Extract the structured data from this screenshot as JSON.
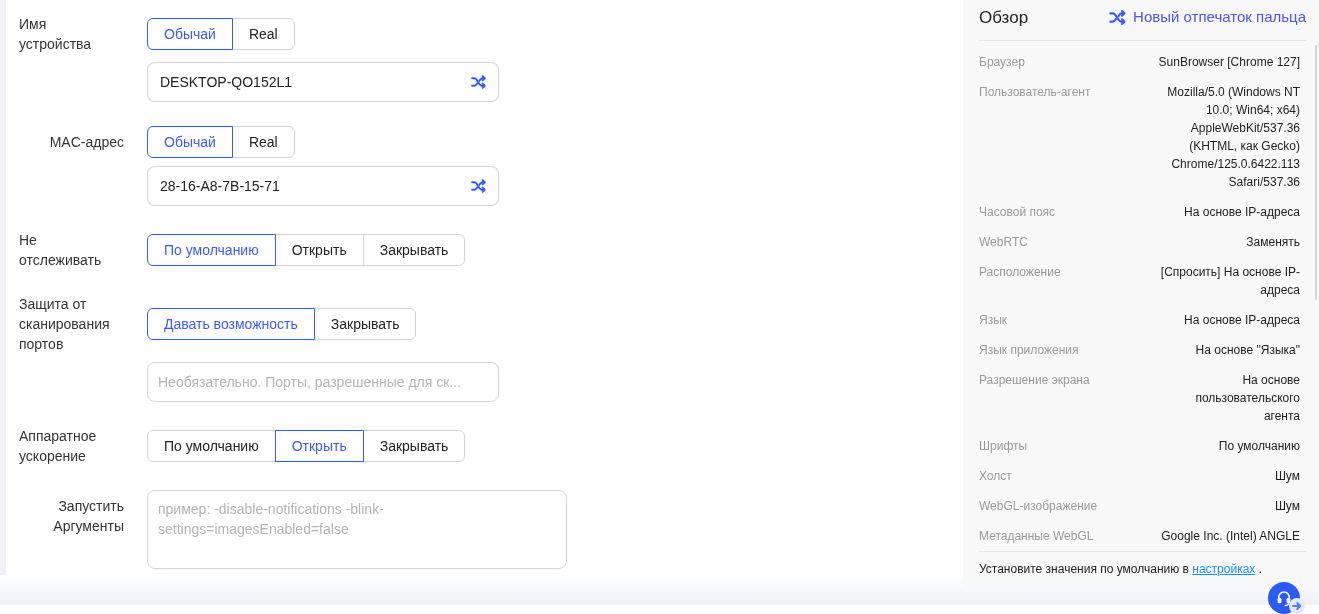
{
  "form": {
    "rows": [
      {
        "label": "Имя устройства",
        "options": [
          {
            "label": "Обычай",
            "selected": true
          },
          {
            "label": "Real",
            "selected": false
          }
        ],
        "field": {
          "kind": "input",
          "value": "DESKTOP-QO152L1",
          "randomize_button": true
        }
      },
      {
        "label": "MAC-адрес",
        "options": [
          {
            "label": "Обычай",
            "selected": true
          },
          {
            "label": "Real",
            "selected": false
          }
        ],
        "field": {
          "kind": "input",
          "value": "28-16-A8-7B-15-71",
          "randomize_button": true
        }
      },
      {
        "label": "Не отслеживать",
        "options": [
          {
            "label": "По умолчанию",
            "selected": true
          },
          {
            "label": "Открыть",
            "selected": false
          },
          {
            "label": "Закрывать",
            "selected": false
          }
        ]
      },
      {
        "label": "Защита от сканирования портов",
        "options": [
          {
            "label": "Давать возможность",
            "selected": true
          },
          {
            "label": "Закрывать",
            "selected": false
          }
        ],
        "field": {
          "kind": "input",
          "placeholder": "Необязательно. Порты, разрешенные для ск..."
        }
      },
      {
        "label": "Аппаратное ускорение",
        "options": [
          {
            "label": "По умолчанию",
            "selected": false
          },
          {
            "label": "Открыть",
            "selected": true
          },
          {
            "label": "Закрывать",
            "selected": false
          }
        ]
      },
      {
        "label": "Запустить Аргументы",
        "field": {
          "kind": "textarea",
          "placeholder": "пример: -disable-notifications -blink-settings=imagesEnabled=false"
        }
      }
    ]
  },
  "overview": {
    "title": "Обзор",
    "action": "Новый отпечаток пальца",
    "items": [
      {
        "label": "Браузер",
        "value": "SunBrowser [Chrome 127]"
      },
      {
        "label": "Пользователь-агент",
        "value": "Mozilla/5.0 (Windows NT 10.0; Win64; x64) AppleWebKit/537.36 (KHTML, как Gecko) Chrome/125.0.6422.113 Safari/537.36"
      },
      {
        "label": "Часовой пояс",
        "value": "На основе IP-адреса"
      },
      {
        "label": "WebRTC",
        "value": "Заменять"
      },
      {
        "label": "Расположение",
        "value": "[Спросить] На основе IP-адреса"
      },
      {
        "label": "Язык",
        "value": "На основе IP-адреса"
      },
      {
        "label": "Язык приложения",
        "value": "На основе \"Языка\""
      },
      {
        "label": "Разрешение экрана",
        "value": "На основе пользовательского агента"
      },
      {
        "label": "Шрифты",
        "value": "По умолчанию"
      },
      {
        "label": "Холст",
        "value": "Шум"
      },
      {
        "label": "WebGL-изображение",
        "value": "Шум"
      },
      {
        "label": "Метаданные WebGL",
        "value": "Google Inc. (Intel) ANGLE"
      }
    ],
    "hint": {
      "text": "Установите значения по умолчанию в",
      "link": "настройках",
      "end": "."
    }
  }
}
